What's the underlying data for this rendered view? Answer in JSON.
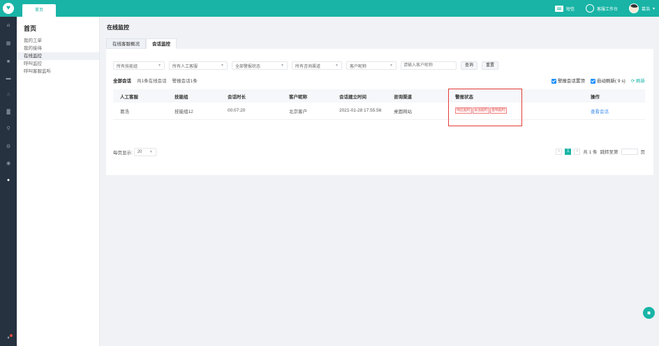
{
  "topbar": {
    "logo": "♥",
    "home_tab": "首页",
    "sms_label": "短信",
    "workbench_label": "客服工作台",
    "user_name": "葛浩",
    "user_arrow": "▾"
  },
  "sidebar": {
    "icons": [
      "home-icon",
      "grid-icon",
      "list-icon",
      "chat-icon",
      "user-icon",
      "chart-icon",
      "search-icon",
      "settings-icon",
      "eye-icon",
      "person-icon",
      "bell-icon"
    ]
  },
  "submenu": {
    "title": "首页",
    "items": [
      {
        "label": "我的工单"
      },
      {
        "label": "我的接待"
      },
      {
        "label": "在线监控"
      },
      {
        "label": "呼叫监控"
      },
      {
        "label": "呼叫客服监听"
      }
    ]
  },
  "main": {
    "page_title": "在线监控",
    "tabs": [
      {
        "label": "在线客服概况"
      },
      {
        "label": "会话监控"
      }
    ]
  },
  "filters": {
    "skill_group": "所有技能组",
    "agent": "所有人工客服",
    "alarm_status": "全部警报状态",
    "channel": "所有咨询渠道",
    "customer_field": "客户昵称",
    "search_placeholder": "请输入客户昵称",
    "search_label": "查询",
    "reset_label": "重置"
  },
  "quick_filters": {
    "all": "全部会话",
    "online": "共1条在线会话",
    "alarm": "警报会话1条"
  },
  "toggles": {
    "alarm_top": "警报会话置顶",
    "auto_refresh": "自动刷新( 9 s)",
    "refresh": "刷新"
  },
  "table": {
    "headers": [
      "人工客服",
      "技能组",
      "会话时长",
      "客户昵称",
      "会话建立时间",
      "咨询渠道",
      "警报状态",
      "操作"
    ],
    "rows": [
      {
        "agent": "葛浩",
        "group": "技能组12",
        "duration": "00:07:20",
        "customer": "北京客户",
        "start_time": "2021-01-28 17:55:56",
        "channel": "桌面网站",
        "alarms": [
          "响应超时",
          "会话超时",
          "首响超时"
        ],
        "action": "查看会话"
      }
    ]
  },
  "pagination": {
    "page_size_label": "每页显示:",
    "page_size": "20",
    "prev": "<",
    "current": "1",
    "next": ">",
    "total": "共 1 条",
    "jump_label": "跳转至第",
    "page_unit": "页"
  },
  "colors": {
    "brand": "#19b4a6",
    "sidebar_bg": "#26323f",
    "alarm": "#e53935",
    "checkbox": "#1890ff"
  }
}
